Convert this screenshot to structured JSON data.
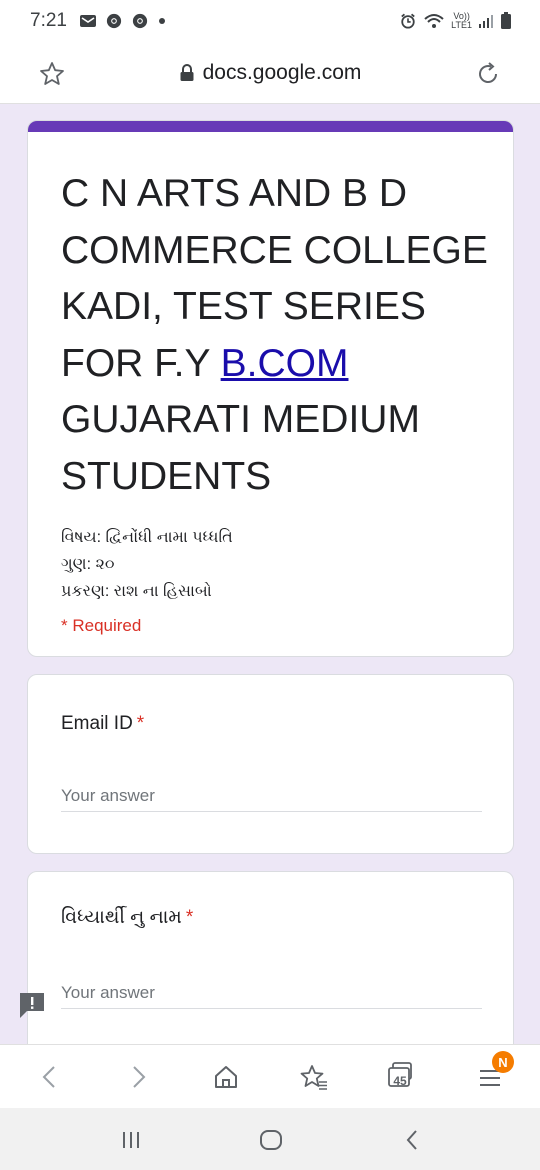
{
  "status_bar": {
    "time": "7:21",
    "lte_top": "Vo))",
    "lte_bottom": "LTE1",
    "left_icons": [
      "mail-icon",
      "chrome-icon",
      "chrome-icon",
      "dot-icon"
    ],
    "right_icons": [
      "alarm-icon",
      "wifi-icon",
      "signal-icon",
      "battery-icon"
    ]
  },
  "browser": {
    "url": "docs.google.com",
    "tab_count": "45",
    "menu_badge": "N"
  },
  "form": {
    "title_part1": "C N ARTS AND B D COMMERCE COLLEGE KADI, TEST SERIES FOR F.Y ",
    "title_link": "B.COM",
    "title_part2": " GUJARATI MEDIUM STUDENTS",
    "description_lines": [
      "વિષય: દ્વિનોંધી નામા પધ્ધતિ",
      "ગુણ: ૨૦",
      "પ્રકરણ: રાશ ના હિસાબો"
    ],
    "required_note": "* Required",
    "questions": [
      {
        "label": "Email ID",
        "required_mark": "*",
        "placeholder": "Your answer"
      },
      {
        "label": "વિધ્યાર્થી નુ નામ",
        "required_mark": "*",
        "placeholder": "Your answer"
      }
    ]
  },
  "colors": {
    "accent": "#673ab7",
    "background": "#ede7f6",
    "required": "#d93025",
    "link": "#1a0dab",
    "badge": "#f57c00"
  }
}
